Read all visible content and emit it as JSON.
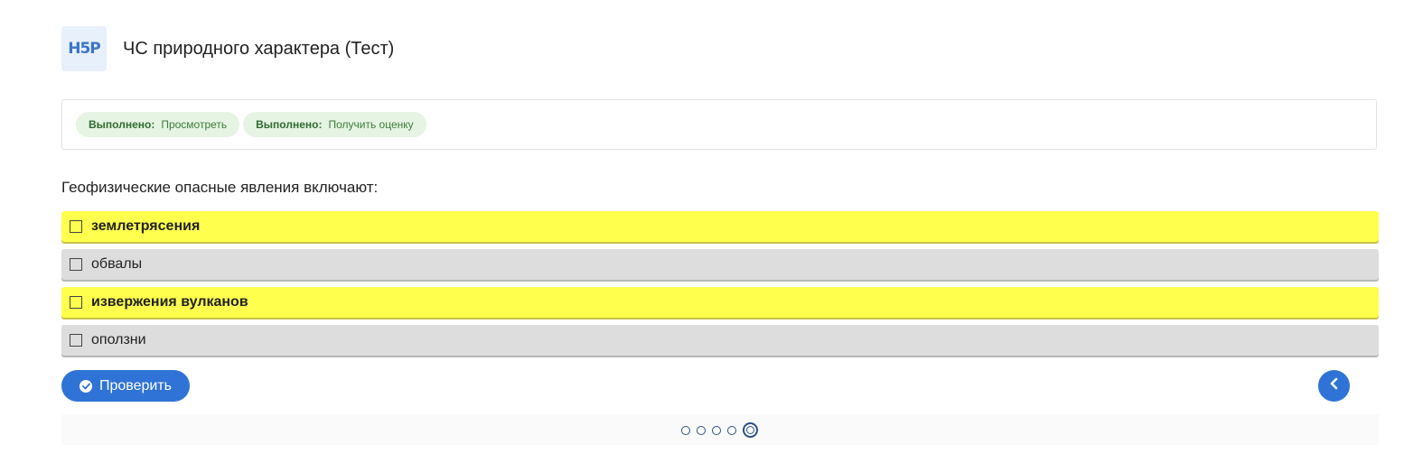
{
  "header": {
    "logo_text": "H5P",
    "title": "ЧС природного характера (Тест)"
  },
  "status": {
    "badges": [
      {
        "label": "Выполнено:",
        "value": "Просмотреть"
      },
      {
        "label": "Выполнено:",
        "value": "Получить оценку"
      }
    ]
  },
  "question": {
    "text": "Геофизические опасные явления включают:",
    "answers": [
      {
        "label": "землетрясения",
        "checked": false,
        "highlighted": true
      },
      {
        "label": "обвалы",
        "checked": false,
        "highlighted": false
      },
      {
        "label": "извержения вулканов",
        "checked": false,
        "highlighted": true
      },
      {
        "label": "оползни",
        "checked": false,
        "highlighted": false
      }
    ]
  },
  "actions": {
    "check_label": "Проверить",
    "check_icon": "check-circle-icon",
    "prev_icon": "chevron-left-icon"
  },
  "navigation": {
    "total_slides": 5,
    "current_slide": 5
  },
  "colors": {
    "accent": "#2f73d6",
    "highlight": "#ffff4d",
    "answer_bg": "#dddddd",
    "badge_bg": "#e6f4e3",
    "badge_text": "#3a7d3a"
  }
}
